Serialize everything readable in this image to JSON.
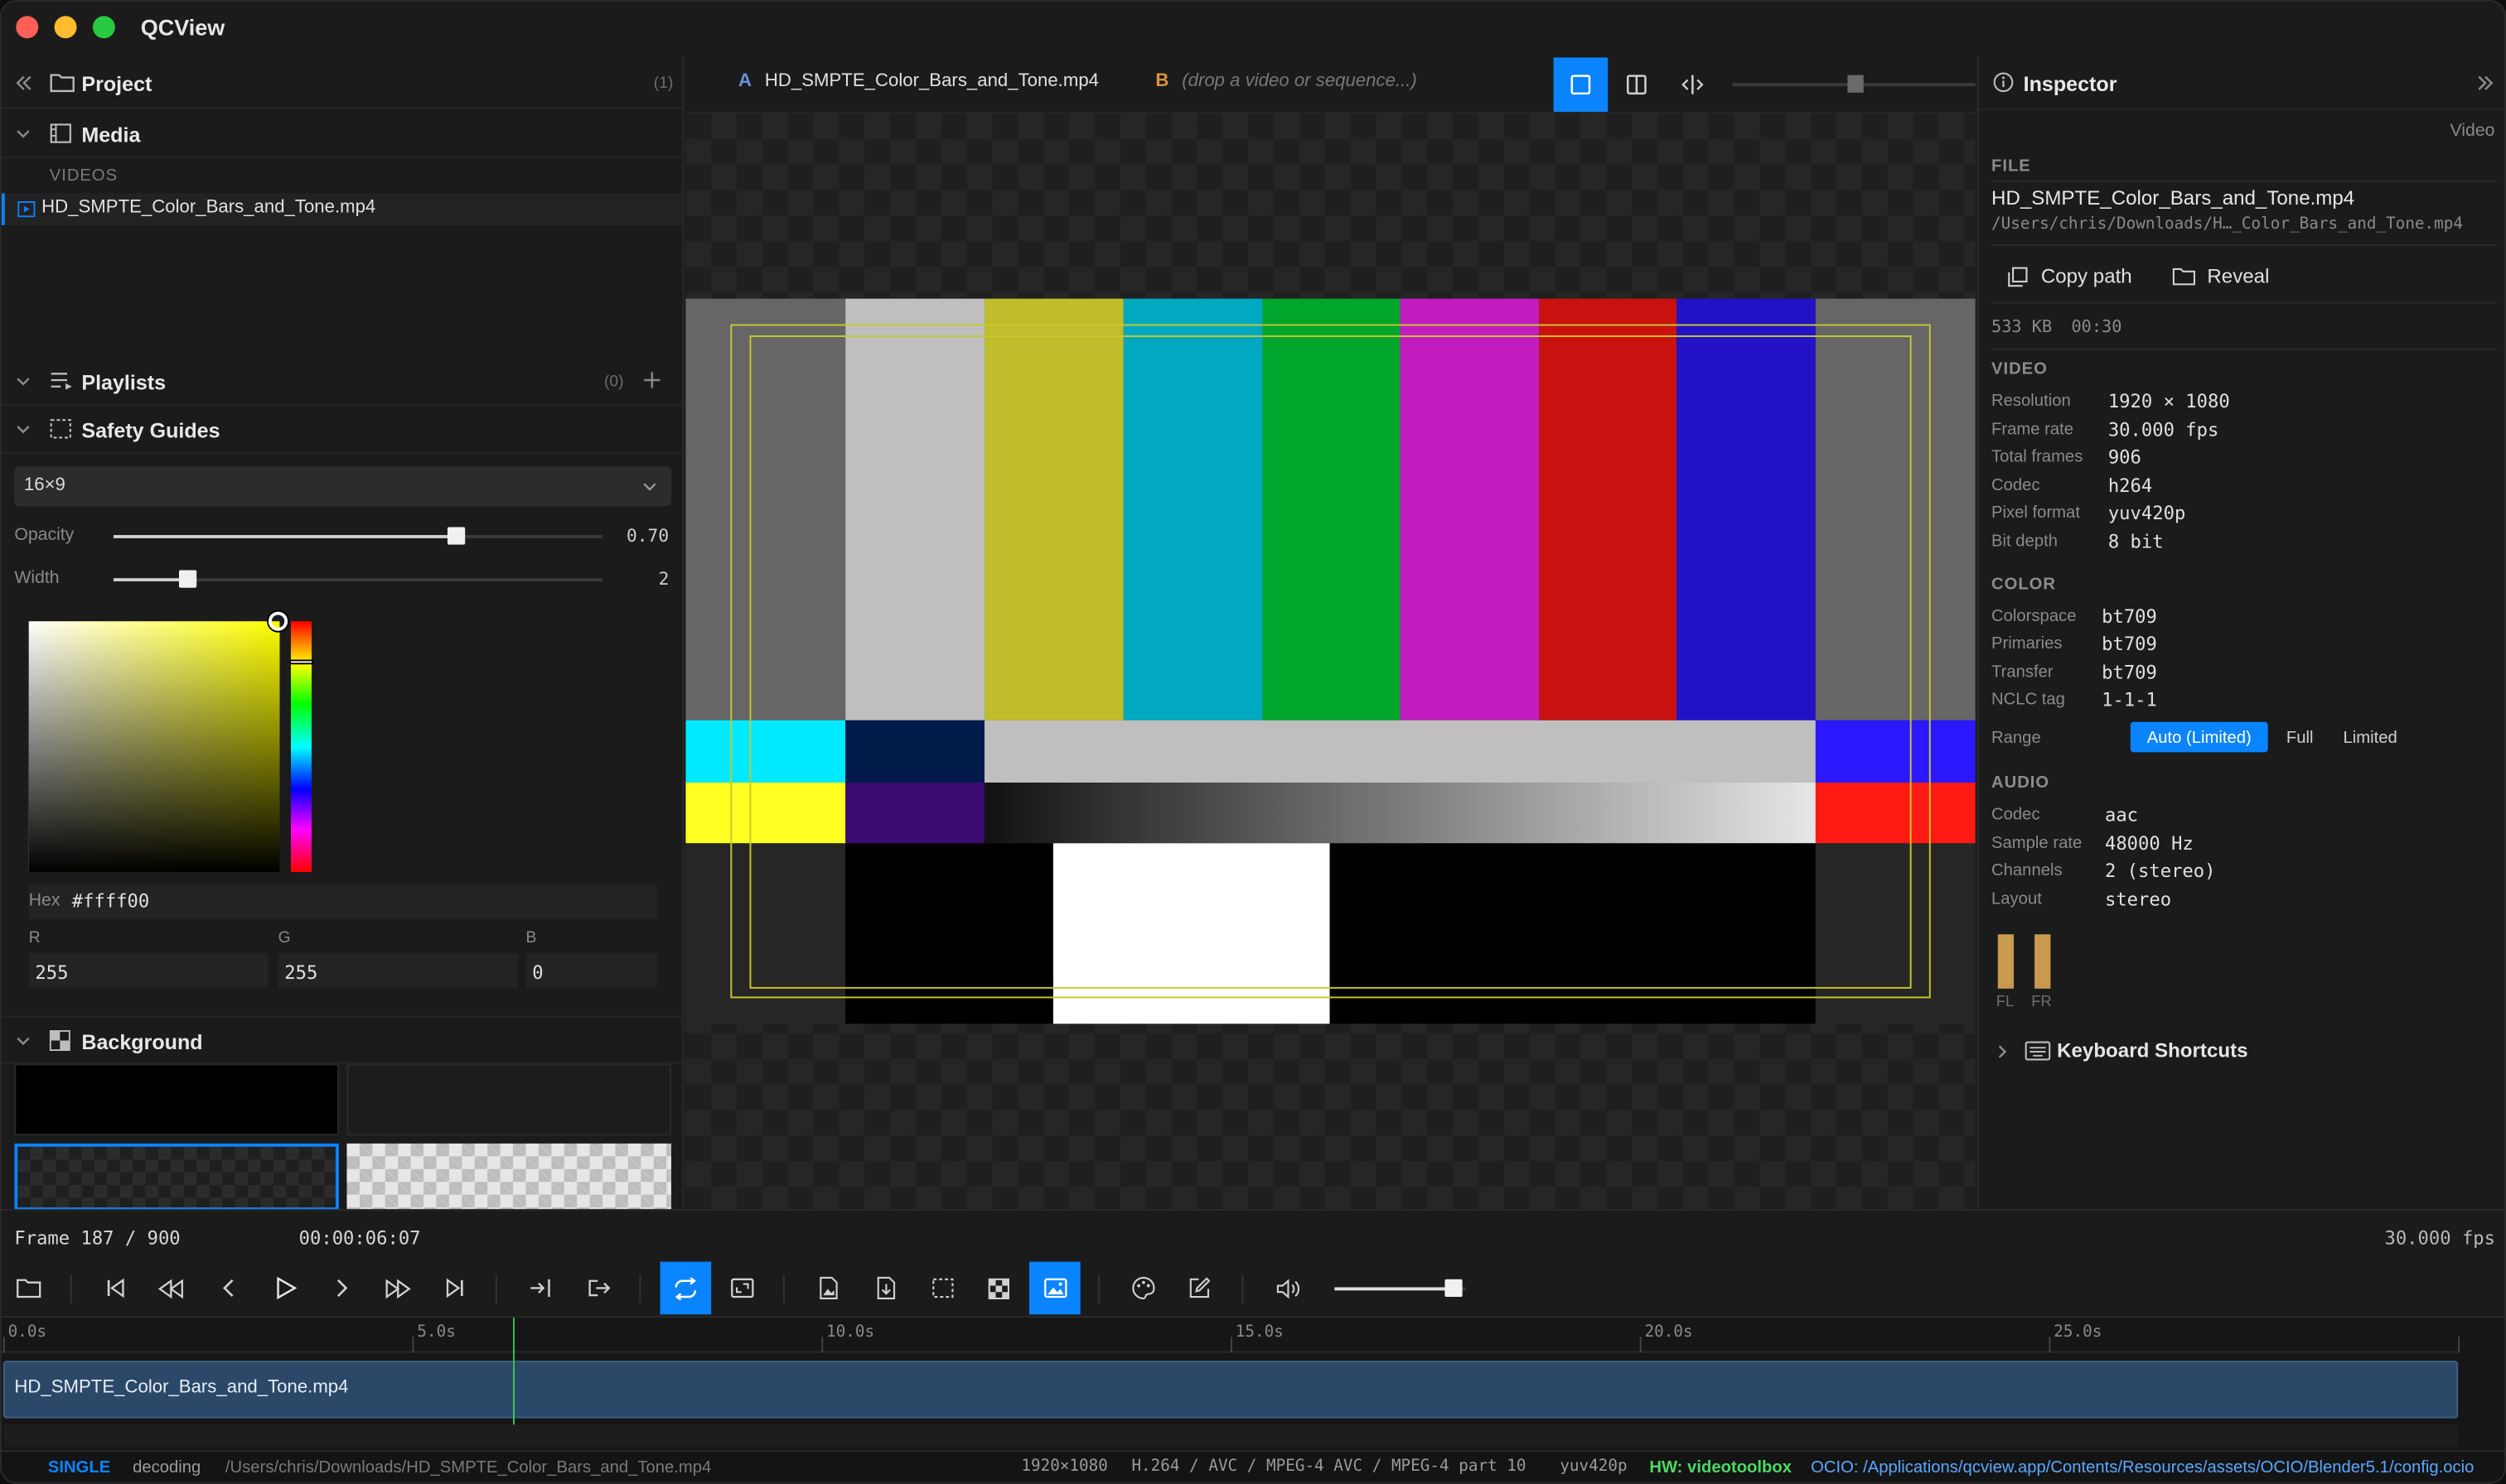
{
  "app": {
    "title": "QCView"
  },
  "colors": {
    "accent": "#0a84ff",
    "guide": "#c8c830",
    "meter": "#c89a50",
    "hw": "#4cd964",
    "ocio": "#5aa8ff"
  },
  "project": {
    "title": "Project",
    "count": "(1)",
    "media": {
      "title": "Media",
      "group_label": "VIDEOS",
      "items": [
        "HD_SMPTE_Color_Bars_and_Tone.mp4"
      ]
    },
    "playlists": {
      "title": "Playlists",
      "count": "(0)"
    },
    "safety": {
      "title": "Safety Guides",
      "aspect": "16×9",
      "opacity_label": "Opacity",
      "opacity_value": "0.70",
      "opacity_fraction": 0.7,
      "width_label": "Width",
      "width_value": "2",
      "width_fraction": 0.15,
      "hex_label": "Hex",
      "hex_value": "#ffff00",
      "r_label": "R",
      "r_value": "255",
      "g_label": "G",
      "g_value": "255",
      "b_label": "B",
      "b_value": "0"
    },
    "background": {
      "title": "Background"
    }
  },
  "viewer": {
    "tab_a_letter": "A",
    "tab_a_name": "HD_SMPTE_Color_Bars_and_Tone.mp4",
    "tab_b_letter": "B",
    "tab_b_placeholder": "(drop a video or sequence...)"
  },
  "inspector": {
    "title": "Inspector",
    "mode": "Video",
    "file_section": "FILE",
    "file_name": "HD_SMPTE_Color_Bars_and_Tone.mp4",
    "file_path": "/Users/chris/Downloads/H…_Color_Bars_and_Tone.mp4",
    "copy_path": "Copy path",
    "reveal": "Reveal",
    "size": "533 KB",
    "duration": "00:30",
    "video_section": "VIDEO",
    "video": [
      {
        "k": "Resolution",
        "v": "1920 × 1080"
      },
      {
        "k": "Frame rate",
        "v": "30.000 fps"
      },
      {
        "k": "Total frames",
        "v": "906"
      },
      {
        "k": "Codec",
        "v": "h264"
      },
      {
        "k": "Pixel format",
        "v": "yuv420p"
      },
      {
        "k": "Bit depth",
        "v": "8 bit"
      }
    ],
    "color_section": "COLOR",
    "color": [
      {
        "k": "Colorspace",
        "v": "bt709"
      },
      {
        "k": "Primaries",
        "v": "bt709"
      },
      {
        "k": "Transfer",
        "v": "bt709"
      },
      {
        "k": "NCLC tag",
        "v": "1-1-1"
      }
    ],
    "range_label": "Range",
    "range_options": [
      "Auto (Limited)",
      "Full",
      "Limited"
    ],
    "audio_section": "AUDIO",
    "audio": [
      {
        "k": "Codec",
        "v": "aac"
      },
      {
        "k": "Sample rate",
        "v": "48000 Hz"
      },
      {
        "k": "Channels",
        "v": "2 (stereo)"
      },
      {
        "k": "Layout",
        "v": "stereo"
      }
    ],
    "meter_labels": [
      "FL",
      "FR"
    ],
    "shortcuts": "Keyboard Shortcuts"
  },
  "transport": {
    "frame_label": "Frame 187 / 900",
    "timecode": "00:00:06:07",
    "fps": "30.000 fps",
    "volume_fraction": 0.9,
    "playhead_seconds": 6.23
  },
  "timeline": {
    "ticks": [
      "0.0s",
      "5.0s",
      "10.0s",
      "15.0s",
      "20.0s",
      "25.0s"
    ],
    "clip": "HD_SMPTE_Color_Bars_and_Tone.mp4"
  },
  "statusbar": {
    "mode": "SINGLE",
    "state": "decoding",
    "path": "/Users/chris/Downloads/HD_SMPTE_Color_Bars_and_Tone.mp4",
    "resolution": "1920×1080",
    "codec": "H.264 / AVC / MPEG-4 AVC / MPEG-4 part 10",
    "pixfmt": "yuv420p",
    "hw": "HW: videotoolbox",
    "ocio": "OCIO: /Applications/qcview.app/Contents/Resources/assets/OCIO/Blender5.1/config.ocio"
  }
}
